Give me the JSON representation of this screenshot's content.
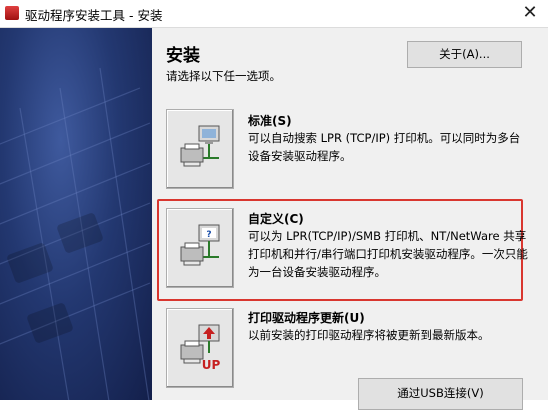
{
  "window": {
    "title": "驱动程序安装工具 - 安装",
    "close_label": "✕"
  },
  "main": {
    "heading": "安装",
    "subtitle": "请选择以下任一选项。",
    "about_button": "关于(A)..."
  },
  "options": [
    {
      "title": "标准(S)",
      "desc": "可以自动搜索 LPR (TCP/IP) 打印机。可以同时为多台设备安装驱动程序。"
    },
    {
      "title": "自定义(C)",
      "desc": "可以为 LPR(TCP/IP)/SMB 打印机、NT/NetWare 共享打印机和并行/串行端口打印机安装驱动程序。一次只能为一台设备安装驱动程序。"
    },
    {
      "title": "打印驱动程序更新(U)",
      "desc": "以前安装的打印驱动程序将被更新到最新版本。"
    }
  ],
  "usb_button": "通过USB连接(V)",
  "icons": {
    "up_badge": "UP",
    "question_mark": "?"
  },
  "colors": {
    "highlight": "#d9362f",
    "left_panel": "#233871"
  }
}
